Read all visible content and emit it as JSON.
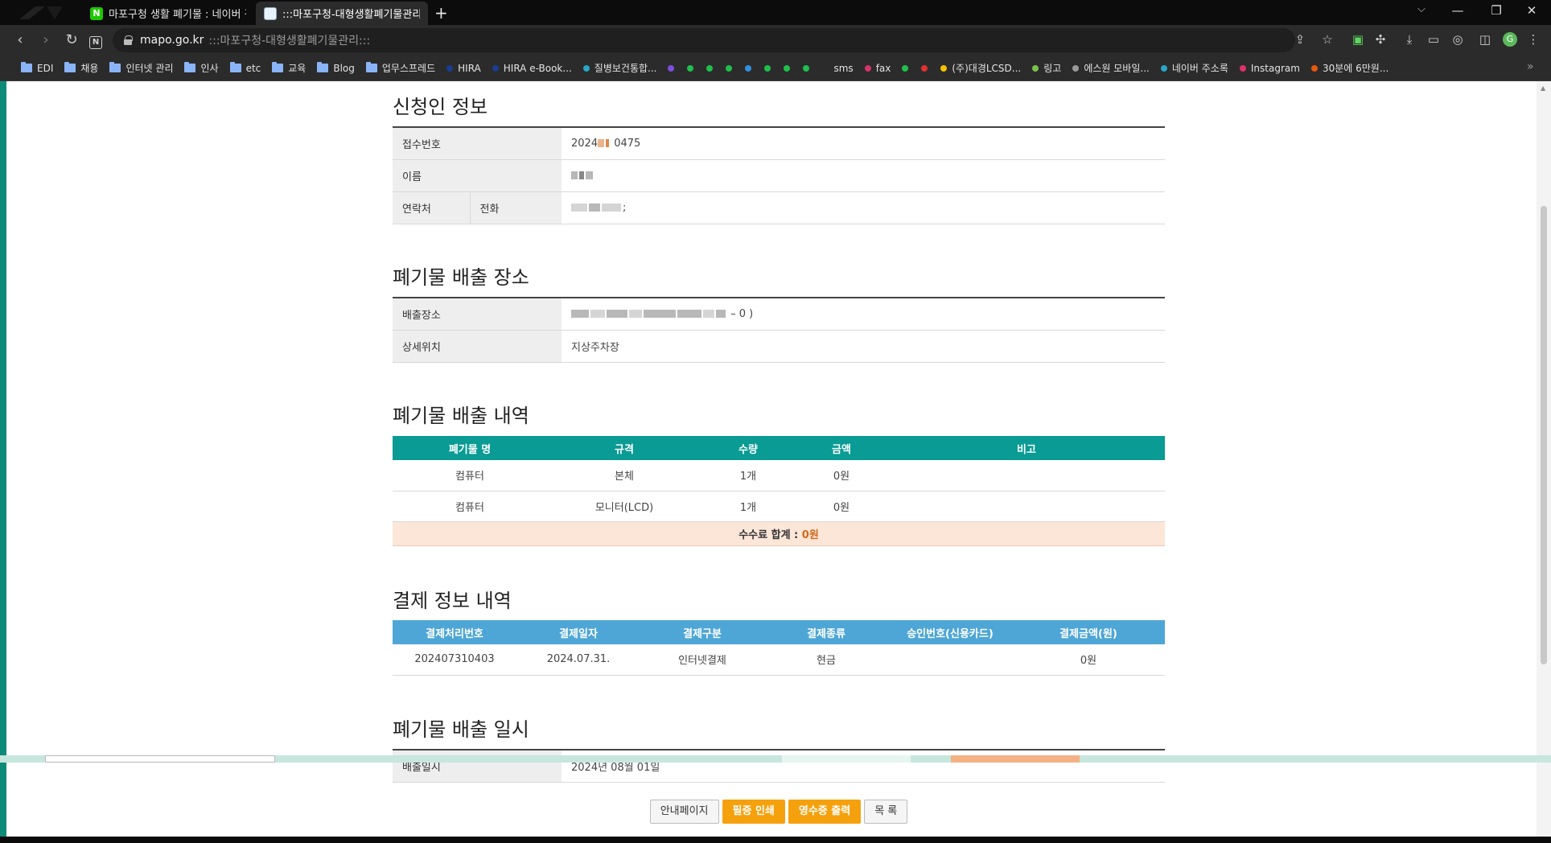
{
  "browser": {
    "tabs": [
      {
        "title": "마포구청 생활 폐기물 : 네이버 검색",
        "favicon": "naver-icon"
      },
      {
        "title": ":::마포구청-대형생활폐기물관리:::",
        "favicon": "mapo-icon"
      }
    ],
    "address": {
      "domain": "mapo.go.kr",
      "path": ":::마포구청-대형생활폐기물관리:::"
    },
    "profile_initial": "G",
    "bookmarks": [
      {
        "label": "EDI",
        "type": "folder"
      },
      {
        "label": "채용",
        "type": "folder"
      },
      {
        "label": "인터넷 관리",
        "type": "folder"
      },
      {
        "label": "인사",
        "type": "folder"
      },
      {
        "label": "etc",
        "type": "folder"
      },
      {
        "label": "교육",
        "type": "folder"
      },
      {
        "label": "Blog",
        "type": "folder"
      },
      {
        "label": "업무스프레드",
        "type": "folder"
      },
      {
        "label": "HIRA",
        "type": "site",
        "color": "#1a3d8f"
      },
      {
        "label": "HIRA e-Book...",
        "type": "site",
        "color": "#1a3d8f"
      },
      {
        "label": "질병보건통합...",
        "type": "site",
        "color": "#2aa6c7"
      },
      {
        "label": "",
        "type": "dot",
        "color": "#7b4fe0"
      },
      {
        "label": "",
        "type": "dot",
        "color": "#1fbf4c"
      },
      {
        "label": "",
        "type": "dot",
        "color": "#1fbf4c"
      },
      {
        "label": "",
        "type": "dot",
        "color": "#1fbf4c"
      },
      {
        "label": "",
        "type": "dot",
        "color": "#2f8fe0"
      },
      {
        "label": "",
        "type": "dot",
        "color": "#1fbf4c"
      },
      {
        "label": "",
        "type": "dot",
        "color": "#1fbf4c"
      },
      {
        "label": "",
        "type": "dot",
        "color": "#1fbf4c"
      },
      {
        "label": "sms",
        "type": "site",
        "color": "#2b2b2b"
      },
      {
        "label": "fax",
        "type": "site",
        "color": "#d6336c"
      },
      {
        "label": "",
        "type": "dot",
        "color": "#1fbf4c"
      },
      {
        "label": "",
        "type": "dot",
        "color": "#e03131"
      },
      {
        "label": "(주)대경LCSD...",
        "type": "site",
        "color": "#f2c200"
      },
      {
        "label": "링고",
        "type": "site",
        "color": "#7cc24a"
      },
      {
        "label": "에스원 모바일...",
        "type": "site",
        "color": "#9a9a9a"
      },
      {
        "label": "네이버 주소록",
        "type": "site",
        "color": "#2aa6c7"
      },
      {
        "label": "Instagram",
        "type": "site",
        "color": "#e1306c"
      },
      {
        "label": "30분에 6만원...",
        "type": "site",
        "color": "#e8590c"
      }
    ]
  },
  "applicant": {
    "title": "신청인 정보",
    "receipt_label": "접수번호",
    "receipt_prefix": "2024",
    "receipt_suffix": "0475",
    "name_label": "이름",
    "contact_label": "연락처",
    "phone_label": "전화",
    "phone_tail": ";"
  },
  "location": {
    "title": "폐기물 배출 장소",
    "place_label": "배출장소",
    "place_tail": "– 0 )",
    "detail_label": "상세위치",
    "detail_value": "지상주차장"
  },
  "waste": {
    "title": "폐기물 배출 내역",
    "columns": [
      "폐기물 명",
      "규격",
      "수량",
      "금액",
      "비고"
    ],
    "rows": [
      [
        "컴퓨터",
        "본체",
        "1개",
        "0원",
        ""
      ],
      [
        "컴퓨터",
        "모니터(LCD)",
        "1개",
        "0원",
        ""
      ]
    ],
    "fee_label": "수수료 합계 : ",
    "fee_value": "0원"
  },
  "payment": {
    "title": "결제 정보 내역",
    "columns": [
      "결제처리번호",
      "결제일자",
      "결제구분",
      "결제종류",
      "승인번호(신용카드)",
      "결제금액(원)"
    ],
    "rows": [
      [
        "202407310403",
        "2024.07.31.",
        "인터넷결제",
        "현금",
        "",
        "0원"
      ]
    ]
  },
  "discharge": {
    "title": "폐기물 배출 일시",
    "date_label": "배출일시",
    "date_value": "2024년 08월 01일"
  },
  "buttons": {
    "guide": "안내페이지",
    "print_cert": "필증 인쇄",
    "print_receipt": "영수증 출력",
    "list": "목 록"
  },
  "colors": {
    "teal_header": "#099b94",
    "blue_header": "#4ea6d6",
    "accent_orange": "#f5a10d",
    "fee_bg": "#fbe6d8"
  }
}
